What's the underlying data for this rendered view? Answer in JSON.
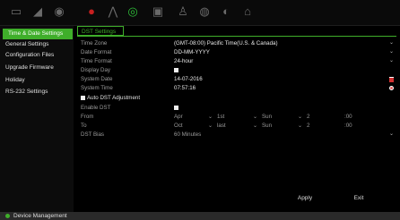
{
  "toolbar": {
    "icons": [
      "monitor-icon",
      "camera-icon",
      "record-icon",
      "playback-icon",
      "analytics-icon",
      "network-icon",
      "storage-icon",
      "alarm-icon",
      "user-icon",
      "device-icon",
      "home-icon"
    ]
  },
  "sidebar": {
    "items": [
      {
        "label": "Time & Date Settings"
      },
      {
        "label": "General Settings"
      },
      {
        "label": "Configuration Files"
      },
      {
        "label": "Upgrade Firmware"
      },
      {
        "label": "Holiday"
      },
      {
        "label": "RS-232 Settings"
      }
    ]
  },
  "tab": {
    "label": "DST Settings"
  },
  "fields": {
    "time_zone": {
      "label": "Time Zone",
      "value": "(GMT-08:00) Pacific Time(U.S. & Canada)"
    },
    "date_format": {
      "label": "Date Format",
      "value": "DD-MM-YYYY"
    },
    "time_format": {
      "label": "Time Format",
      "value": "24-hour"
    },
    "display_day": {
      "label": "Display Day"
    },
    "system_date": {
      "label": "System Date",
      "value": "14-07-2016"
    },
    "system_time": {
      "label": "System Time",
      "value": "07:57:16"
    },
    "auto_dst": {
      "label": "Auto DST Adjustment"
    },
    "enable_dst": {
      "label": "Enable DST"
    },
    "from": {
      "label": "From",
      "month": "Apr",
      "week": "1st",
      "day": "Sun",
      "hour": "2",
      "min": ":00"
    },
    "to": {
      "label": "To",
      "month": "Oct",
      "week": "last",
      "day": "Sun",
      "hour": "2",
      "min": ":00"
    },
    "dst_bias": {
      "label": "DST Bias",
      "value": "60 Minutes"
    }
  },
  "buttons": {
    "apply": "Apply",
    "exit": "Exit"
  },
  "footer": {
    "label": "Device Management"
  },
  "colors": {
    "accent": "#3fae2a",
    "background": "#000000"
  }
}
